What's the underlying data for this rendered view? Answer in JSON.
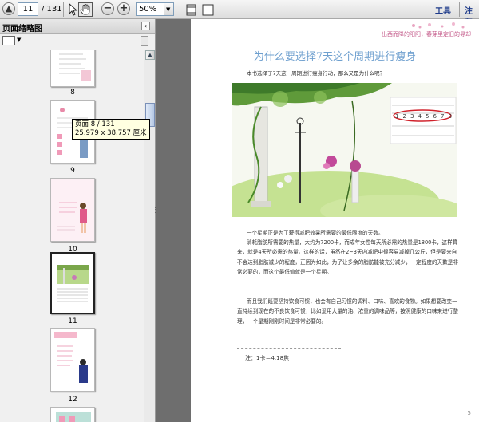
{
  "toolbar": {
    "page_current": "11",
    "page_total": "/ 131",
    "zoom": "50%",
    "tools_menu": "工具",
    "annotate_menu": "注释"
  },
  "panel": {
    "title": "页面缩略图",
    "thumbnails": [
      {
        "label": "8"
      },
      {
        "label": "9"
      },
      {
        "label": "10"
      },
      {
        "label": "11"
      },
      {
        "label": "12"
      }
    ],
    "tooltip": {
      "line1": "页面 8 / 131",
      "line2": "25.979 x 38.757 厘米"
    }
  },
  "page": {
    "header_text": "出西而降的阳阳，春芽里定旧的寻却",
    "title": "为什么要选择7天这个周期进行瘦身",
    "intro": "本书选择了7天这一周期进行瘦身行动，那么又是为什么呢？",
    "calendar_row1": [
      "1",
      "2",
      "3",
      "4",
      "5",
      "6",
      "7",
      "8"
    ],
    "paragraphs": [
      "一个星期正是为了获得减肥效果所需要的最低限度的天数。",
      "消耗脂肪所需要的热量，大约为7200卡，而成年女性每天所必需的热量是1800卡，这样算来，就是4天所必需的热量。这样的话，虽然在2~3天内减肥中很容易减掉几公斤，但是要来自不会达到脂肪减少的程度，正因为如此，为了让多余的脂肪能被充分减少，一定程度的天数是非常必要的，而这个最低值就是一个星期。",
      "而且我们既要坚持饮食可惯，也会有自己习惯的调料、口味、喜欢的食物。如果想要改变一直持续到现在的不良饮食可惯，比如爱用大量的油、浓重的调味品等，按照健康的口味来进行整理，一个星期刚刚时间是非常必要的。"
    ],
    "note": "注：1卡＝4.18焦",
    "page_number": "5"
  }
}
